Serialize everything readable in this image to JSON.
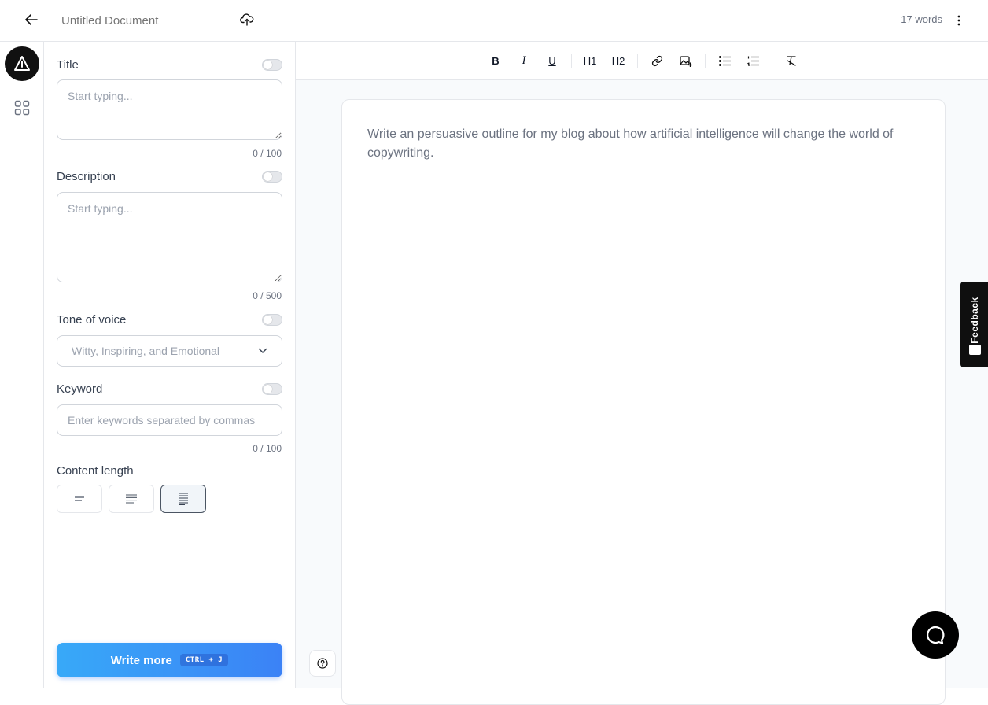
{
  "header": {
    "doc_title_placeholder": "Untitled Document",
    "word_count": "17 words"
  },
  "panel": {
    "title": {
      "label": "Title",
      "placeholder": "Start typing...",
      "counter": "0 / 100"
    },
    "description": {
      "label": "Description",
      "placeholder": "Start typing...",
      "counter": "0 / 500"
    },
    "tone": {
      "label": "Tone of voice",
      "value": "Witty, Inspiring, and Emotional"
    },
    "keyword": {
      "label": "Keyword",
      "placeholder": "Enter keywords separated by commas",
      "counter": "0 / 100"
    },
    "content_length": {
      "label": "Content length",
      "options": [
        "short",
        "medium",
        "long"
      ],
      "selected": "long"
    },
    "write_more": {
      "label": "Write more",
      "shortcut": "CTRL + J"
    }
  },
  "toolbar": {
    "h1": "H1",
    "h2": "H2"
  },
  "editor": {
    "content": "Write an persuasive outline for my blog about how artificial intelligence will change the world of copywriting."
  },
  "feedback": {
    "label": "Feedback"
  },
  "colors": {
    "accent": "#3b82f6",
    "dark": "#000000"
  }
}
